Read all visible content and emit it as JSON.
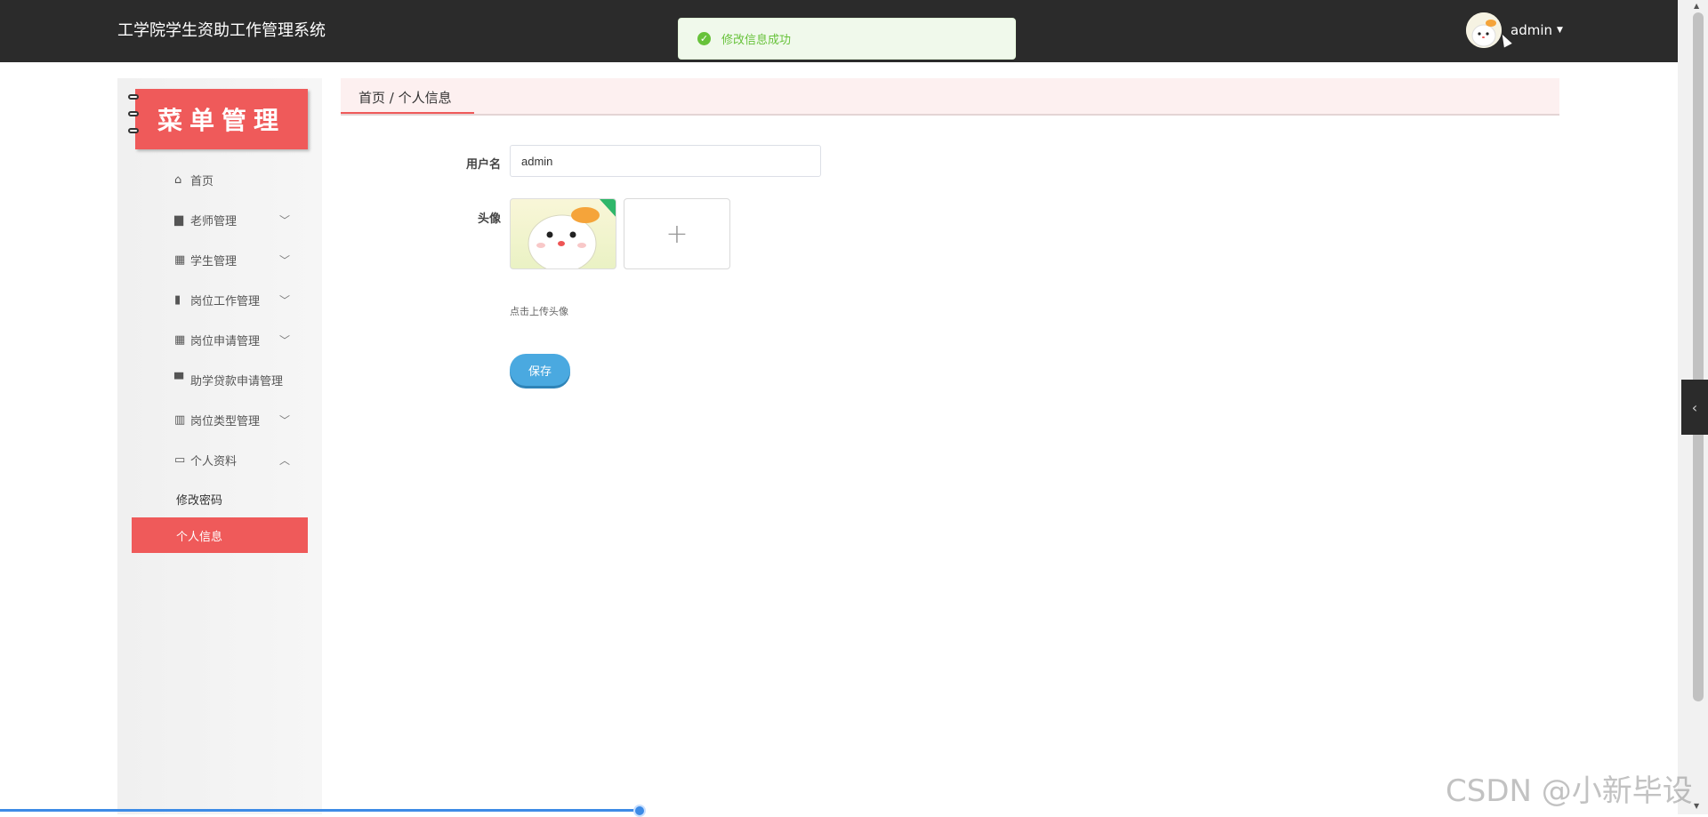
{
  "header": {
    "app_title": "工学院学生资助工作管理系统",
    "toast_message": "修改信息成功",
    "user_name": "admin"
  },
  "sidebar": {
    "banner_title": "菜单管理",
    "items": [
      {
        "label": "首页",
        "icon": "home-icon"
      },
      {
        "label": "老师管理",
        "icon": "briefcase-icon"
      },
      {
        "label": "学生管理",
        "icon": "grid-icon"
      },
      {
        "label": "岗位工作管理",
        "icon": "clipboard-icon"
      },
      {
        "label": "岗位申请管理",
        "icon": "grid-icon"
      },
      {
        "label": "助学贷款申请管理",
        "icon": "monitor-icon"
      },
      {
        "label": "岗位类型管理",
        "icon": "book-icon"
      },
      {
        "label": "个人资料",
        "icon": "id-card-icon"
      }
    ],
    "sub_items": [
      {
        "label": "修改密码"
      },
      {
        "label": "个人信息"
      }
    ]
  },
  "breadcrumb": {
    "text": "首页 / 个人信息"
  },
  "form": {
    "username_label": "用户名",
    "username_value": "admin",
    "avatar_label": "头像",
    "upload_hint": "点击上传头像",
    "save_label": "保存"
  },
  "watermark": "CSDN @小新毕设",
  "colors": {
    "topbar": "#2b2b2b",
    "accent": "#ef5a5a",
    "success": "#67c23a",
    "primary_button": "#4aa9e0"
  }
}
